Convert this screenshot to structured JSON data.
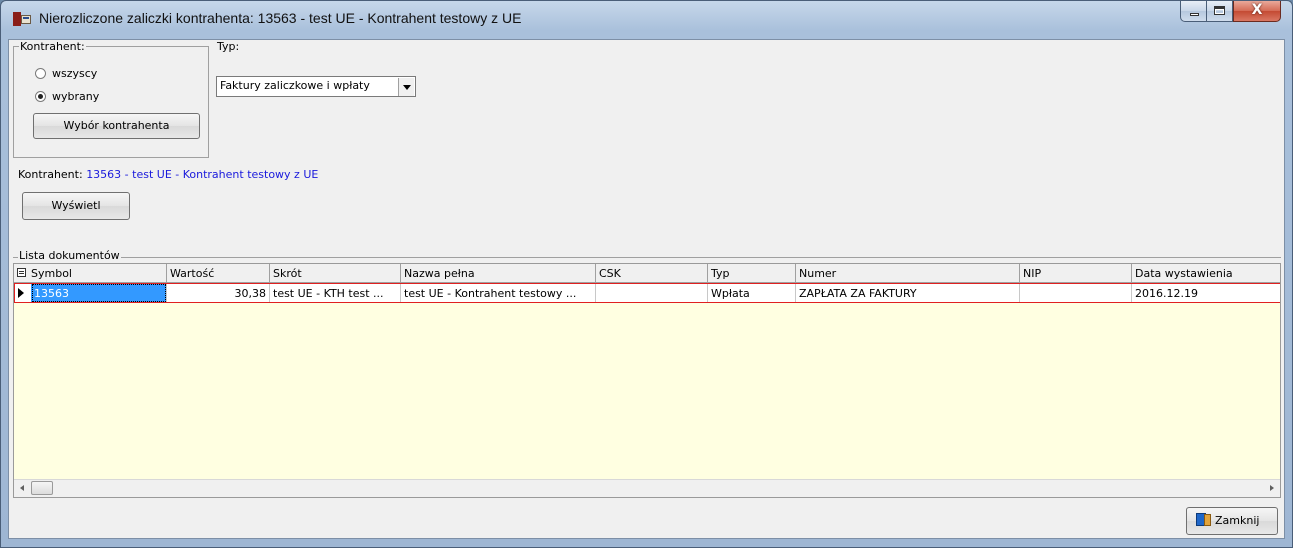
{
  "window": {
    "title": "Nierozliczone zaliczki kontrahenta: 13563 - test UE - Kontrahent testowy z UE",
    "close_glyph": "X"
  },
  "kontrahent_group": {
    "label": "Kontrahent:",
    "options": [
      {
        "label": "wszyscy",
        "checked": false
      },
      {
        "label": "wybrany",
        "checked": true
      }
    ],
    "select_button": "Wybór kontrahenta"
  },
  "typ": {
    "label": "Typ:",
    "selected": "Faktury zaliczkowe i wpłaty"
  },
  "kontrahent_line": {
    "label": "Kontrahent:",
    "value": "13563 - test UE - Kontrahent testowy z UE"
  },
  "show_button": "Wyświetl",
  "documents": {
    "label": "Lista dokumentów",
    "columns": [
      "Symbol",
      "Wartość",
      "Skrót",
      "Nazwa pełna",
      "CSK",
      "Typ",
      "Numer",
      "NIP",
      "Data wystawienia"
    ],
    "rows": [
      [
        "13563",
        "30,38",
        "test UE - KTH test ...",
        "test UE - Kontrahent testowy ...",
        "",
        "Wpłata",
        "ZAPŁATA ZA FAKTURY",
        "",
        "2016.12.19"
      ]
    ]
  },
  "close_button": "Zamknij",
  "colors": {
    "grid_background": "#ffffe1",
    "selection": "#3399ff",
    "row_outline": "#e02020",
    "link_blue": "#1a1adc"
  }
}
